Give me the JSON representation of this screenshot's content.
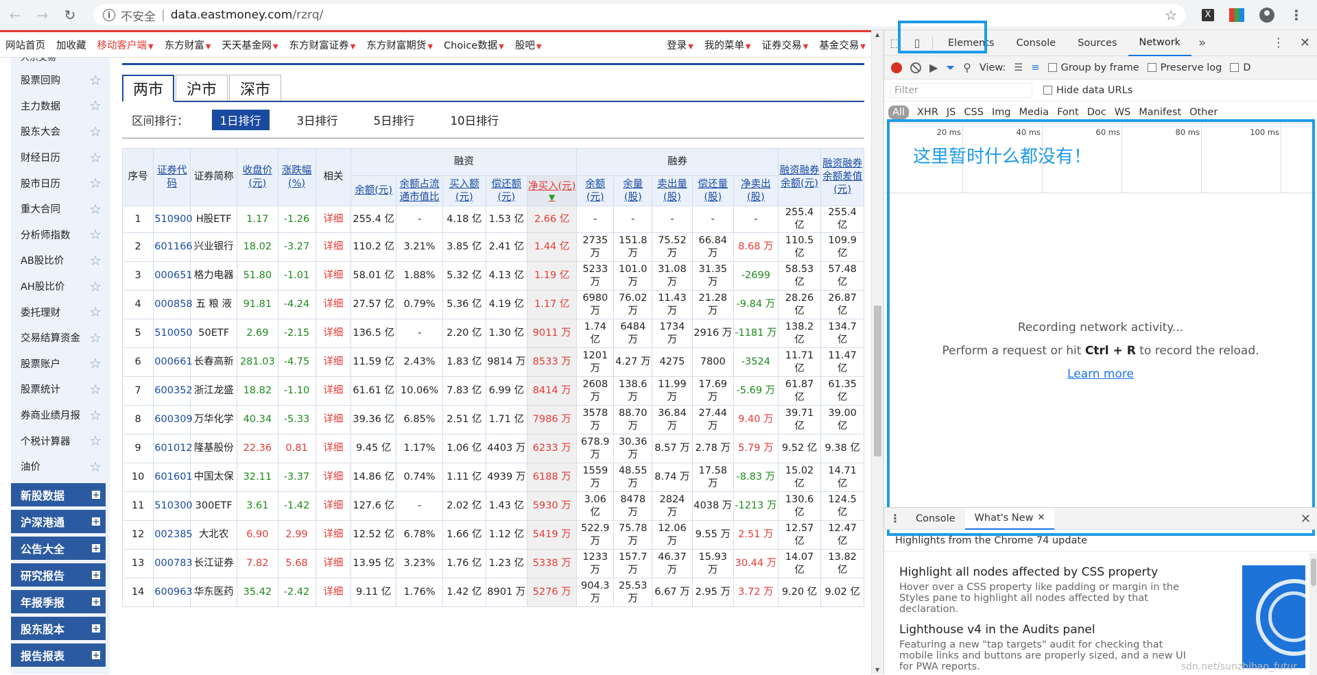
{
  "browser": {
    "insecure_label": "不安全",
    "host": "data.eastmoney.com",
    "path": "/rzrq/",
    "ext_x_label": "X"
  },
  "topnav": {
    "left": [
      "网站首页",
      "加收藏"
    ],
    "mobile": "移动客户端",
    "dropdowns": [
      "东方财富",
      "天天基金网",
      "东方财富证券",
      "东方财富期货",
      "Choice数据",
      "股吧"
    ],
    "right": [
      "登录",
      "我的菜单",
      "证券交易",
      "基金交易"
    ]
  },
  "sidebar": {
    "cut_item": "大宗交易",
    "items": [
      "股票回购",
      "主力数据",
      "股东大会",
      "财经日历",
      "股市日历",
      "重大合同",
      "分析师指数",
      "AB股比价",
      "AH股比价",
      "委托理财",
      "交易结算资金",
      "股票账户",
      "股票统计",
      "券商业绩月报",
      "个税计算器",
      "油价"
    ],
    "categories": [
      "新股数据",
      "沪深港通",
      "公告大全",
      "研究报告",
      "年报季报",
      "股东股本",
      "报告报表"
    ]
  },
  "market_tabs": [
    "两市",
    "沪市",
    "深市"
  ],
  "range": {
    "label": "区间排行：",
    "options": [
      "1日排行",
      "3日排行",
      "5日排行",
      "10日排行"
    ]
  },
  "table": {
    "headers": {
      "seq": "序号",
      "code": "证券代码",
      "name": "证券简称",
      "close": "收盘价(元)",
      "change": "涨跌幅(%)",
      "related": "相关",
      "rz_group": "融资",
      "rq_group": "融券",
      "rzrq_balance": "融资融券余额(元)",
      "rzrq_diff": "融资融券余额差值(元)",
      "rz_cols": [
        "余额(元)",
        "余额占流通市值比",
        "买入额(元)",
        "偿还额(元)",
        "净买入(元)"
      ],
      "rq_cols": [
        "余额(元)",
        "余量(股)",
        "卖出量(股)",
        "偿还量(股)",
        "净卖出(股)"
      ]
    },
    "rows": [
      {
        "seq": "1",
        "code": "510900",
        "name": "H股ETF",
        "close": "1.17",
        "change": "-1.26",
        "detail": "详细",
        "rz_bal": "255.4 亿",
        "rz_ratio": "-",
        "rz_buy": "4.18 亿",
        "rz_repay": "1.53 亿",
        "rz_net": "2.66 亿",
        "rq_bal": "-",
        "rq_vol": "-",
        "rq_sell": "-",
        "rq_repay": "-",
        "rq_net": "-",
        "total": "255.4 亿",
        "diff": "255.4 亿"
      },
      {
        "seq": "2",
        "code": "601166",
        "name": "兴业银行",
        "close": "18.02",
        "change": "-3.27",
        "detail": "详细",
        "rz_bal": "110.2 亿",
        "rz_ratio": "3.21%",
        "rz_buy": "3.85 亿",
        "rz_repay": "2.41 亿",
        "rz_net": "1.44 亿",
        "rq_bal": "2735 万",
        "rq_vol": "151.8 万",
        "rq_sell": "75.52 万",
        "rq_repay": "66.84 万",
        "rq_net": "8.68 万",
        "total": "110.5 亿",
        "diff": "109.9 亿"
      },
      {
        "seq": "3",
        "code": "000651",
        "name": "格力电器",
        "close": "51.80",
        "change": "-1.01",
        "detail": "详细",
        "rz_bal": "58.01 亿",
        "rz_ratio": "1.88%",
        "rz_buy": "5.32 亿",
        "rz_repay": "4.13 亿",
        "rz_net": "1.19 亿",
        "rq_bal": "5233 万",
        "rq_vol": "101.0 万",
        "rq_sell": "31.08 万",
        "rq_repay": "31.35 万",
        "rq_net": "-2699",
        "total": "58.53 亿",
        "diff": "57.48 亿"
      },
      {
        "seq": "4",
        "code": "000858",
        "name": "五 粮 液",
        "close": "91.81",
        "change": "-4.24",
        "detail": "详细",
        "rz_bal": "27.57 亿",
        "rz_ratio": "0.79%",
        "rz_buy": "5.36 亿",
        "rz_repay": "4.19 亿",
        "rz_net": "1.17 亿",
        "rq_bal": "6980 万",
        "rq_vol": "76.02 万",
        "rq_sell": "11.43 万",
        "rq_repay": "21.28 万",
        "rq_net": "-9.84 万",
        "total": "28.26 亿",
        "diff": "26.87 亿"
      },
      {
        "seq": "5",
        "code": "510050",
        "name": "50ETF",
        "close": "2.69",
        "change": "-2.15",
        "detail": "详细",
        "rz_bal": "136.5 亿",
        "rz_ratio": "-",
        "rz_buy": "2.20 亿",
        "rz_repay": "1.30 亿",
        "rz_net": "9011 万",
        "rq_bal": "1.74 亿",
        "rq_vol": "6484 万",
        "rq_sell": "1734 万",
        "rq_repay": "2916 万",
        "rq_net": "-1181 万",
        "total": "138.2 亿",
        "diff": "134.7 亿"
      },
      {
        "seq": "6",
        "code": "000661",
        "name": "长春高新",
        "close": "281.03",
        "change": "-4.75",
        "detail": "详细",
        "rz_bal": "11.59 亿",
        "rz_ratio": "2.43%",
        "rz_buy": "1.83 亿",
        "rz_repay": "9814 万",
        "rz_net": "8533 万",
        "rq_bal": "1201 万",
        "rq_vol": "4.27 万",
        "rq_sell": "4275",
        "rq_repay": "7800",
        "rq_net": "-3524",
        "total": "11.71 亿",
        "diff": "11.47 亿"
      },
      {
        "seq": "7",
        "code": "600352",
        "name": "浙江龙盛",
        "close": "18.82",
        "change": "-1.10",
        "detail": "详细",
        "rz_bal": "61.61 亿",
        "rz_ratio": "10.06%",
        "rz_buy": "7.83 亿",
        "rz_repay": "6.99 亿",
        "rz_net": "8414 万",
        "rq_bal": "2608 万",
        "rq_vol": "138.6 万",
        "rq_sell": "11.99 万",
        "rq_repay": "17.69 万",
        "rq_net": "-5.69 万",
        "total": "61.87 亿",
        "diff": "61.35 亿"
      },
      {
        "seq": "8",
        "code": "600309",
        "name": "万华化学",
        "close": "40.34",
        "change": "-5.33",
        "detail": "详细",
        "rz_bal": "39.36 亿",
        "rz_ratio": "6.85%",
        "rz_buy": "2.51 亿",
        "rz_repay": "1.71 亿",
        "rz_net": "7986 万",
        "rq_bal": "3578 万",
        "rq_vol": "88.70 万",
        "rq_sell": "36.84 万",
        "rq_repay": "27.44 万",
        "rq_net": "9.40 万",
        "total": "39.71 亿",
        "diff": "39.00 亿"
      },
      {
        "seq": "9",
        "code": "601012",
        "name": "隆基股份",
        "close": "22.36",
        "change": "0.81",
        "detail": "详细",
        "rz_bal": "9.45 亿",
        "rz_ratio": "1.17%",
        "rz_buy": "1.06 亿",
        "rz_repay": "4403 万",
        "rz_net": "6233 万",
        "rq_bal": "678.9 万",
        "rq_vol": "30.36 万",
        "rq_sell": "8.57 万",
        "rq_repay": "2.78 万",
        "rq_net": "5.79 万",
        "total": "9.52 亿",
        "diff": "9.38 亿"
      },
      {
        "seq": "10",
        "code": "601601",
        "name": "中国太保",
        "close": "32.11",
        "change": "-3.37",
        "detail": "详细",
        "rz_bal": "14.86 亿",
        "rz_ratio": "0.74%",
        "rz_buy": "1.11 亿",
        "rz_repay": "4939 万",
        "rz_net": "6188 万",
        "rq_bal": "1559 万",
        "rq_vol": "48.55 万",
        "rq_sell": "8.74 万",
        "rq_repay": "17.58 万",
        "rq_net": "-8.83 万",
        "total": "15.02 亿",
        "diff": "14.71 亿"
      },
      {
        "seq": "11",
        "code": "510300",
        "name": "300ETF",
        "close": "3.61",
        "change": "-1.42",
        "detail": "详细",
        "rz_bal": "127.6 亿",
        "rz_ratio": "-",
        "rz_buy": "2.02 亿",
        "rz_repay": "1.43 亿",
        "rz_net": "5930 万",
        "rq_bal": "3.06 亿",
        "rq_vol": "8478 万",
        "rq_sell": "2824 万",
        "rq_repay": "4038 万",
        "rq_net": "-1213 万",
        "total": "130.6 亿",
        "diff": "124.5 亿"
      },
      {
        "seq": "12",
        "code": "002385",
        "name": "大北农",
        "close": "6.90",
        "change": "2.99",
        "detail": "详细",
        "rz_bal": "12.52 亿",
        "rz_ratio": "6.78%",
        "rz_buy": "1.66 亿",
        "rz_repay": "1.12 亿",
        "rz_net": "5419 万",
        "rq_bal": "522.9 万",
        "rq_vol": "75.78 万",
        "rq_sell": "12.06 万",
        "rq_repay": "9.55 万",
        "rq_net": "2.51 万",
        "total": "12.57 亿",
        "diff": "12.47 亿"
      },
      {
        "seq": "13",
        "code": "000783",
        "name": "长江证券",
        "close": "7.82",
        "change": "5.68",
        "detail": "详细",
        "rz_bal": "13.95 亿",
        "rz_ratio": "3.23%",
        "rz_buy": "1.76 亿",
        "rz_repay": "1.23 亿",
        "rz_net": "5338 万",
        "rq_bal": "1233 万",
        "rq_vol": "157.7 万",
        "rq_sell": "46.37 万",
        "rq_repay": "15.93 万",
        "rq_net": "30.44 万",
        "total": "14.07 亿",
        "diff": "13.82 亿"
      },
      {
        "seq": "14",
        "code": "600963",
        "name": "华东医药",
        "close": "35.42",
        "change": "-2.42",
        "detail": "详细",
        "rz_bal": "9.11 亿",
        "rz_ratio": "1.76%",
        "rz_buy": "1.42 亿",
        "rz_repay": "8901 万",
        "rz_net": "5276 万",
        "rq_bal": "904.3 万",
        "rq_vol": "25.53 万",
        "rq_sell": "6.67 万",
        "rq_repay": "2.95 万",
        "rq_net": "3.72 万",
        "total": "9.20 亿",
        "diff": "9.02 亿"
      }
    ]
  },
  "devtools": {
    "tabs": [
      "Elements",
      "Console",
      "Sources",
      "Network"
    ],
    "active_tab": "Network",
    "controls": {
      "view_label": "View:",
      "group_by_frame": "Group by frame",
      "preserve_log": "Preserve log",
      "disable_cache_cut": "D"
    },
    "filter_placeholder": "Filter",
    "hide_data_urls": "Hide data URLs",
    "types": [
      "All",
      "XHR",
      "JS",
      "CSS",
      "Img",
      "Media",
      "Font",
      "Doc",
      "WS",
      "Manifest",
      "Other"
    ],
    "timeline_ticks": [
      "20 ms",
      "40 ms",
      "60 ms",
      "80 ms",
      "100 ms"
    ],
    "annotation": "这里暂时什么都没有！",
    "empty": {
      "line1": "Recording network activity...",
      "line2_pre": "Perform a request or hit ",
      "line2_key": "Ctrl + R",
      "line2_post": " to record the reload.",
      "learn_more": "Learn more"
    },
    "drawer": {
      "tabs": [
        "Console",
        "What's New"
      ],
      "active": "What's New",
      "headline": "Highlights from the Chrome 74 update",
      "items": [
        {
          "title": "Highlight all nodes affected by CSS property",
          "text": "Hover over a CSS property like padding or margin in the Styles pane to highlight all nodes affected by that declaration."
        },
        {
          "title": "Lighthouse v4 in the Audits panel",
          "text": "Featuring a new \"tap targets\" audit for checking that mobile links and buttons are properly sized, and a new UI for PWA reports."
        }
      ],
      "watermark": "sdn.net/sunzhihao_futur"
    }
  },
  "colors": {
    "accent_blue": "#1a4aa0",
    "red_up": "#e53935",
    "green_down": "#1b8a1b",
    "annotation": "#1e9be8"
  }
}
